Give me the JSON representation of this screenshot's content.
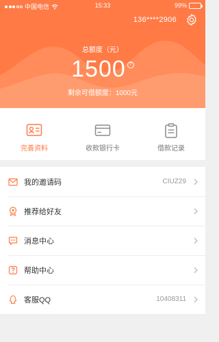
{
  "status_bar": {
    "carrier": "中国电信",
    "time": "15:33",
    "battery": "99%",
    "battery_level": 0.99
  },
  "header": {
    "phone": "136****2906",
    "settings_icon": "gear-icon",
    "total_label": "总额度（元）",
    "amount": "1500",
    "help_mark": "?",
    "remaining": "剩余可借额度：1000元",
    "background_color": "#ff7a45"
  },
  "quick_actions": [
    {
      "label": "完善资料",
      "icon": "id-card-icon",
      "active": true
    },
    {
      "label": "收款银行卡",
      "icon": "bank-card-icon",
      "active": false
    },
    {
      "label": "借款记录",
      "icon": "clipboard-icon",
      "active": false
    }
  ],
  "menu": [
    {
      "label": "我的邀请码",
      "value": "CIUZ29",
      "icon": "envelope-icon"
    },
    {
      "label": "推荐给好友",
      "value": "",
      "icon": "award-icon"
    },
    {
      "label": "消息中心",
      "value": "",
      "icon": "message-icon"
    },
    {
      "label": "帮助中心",
      "value": "",
      "icon": "help-icon"
    },
    {
      "label": "客服QQ",
      "value": "10408311",
      "icon": "qq-icon"
    }
  ],
  "colors": {
    "accent": "#ff7a45",
    "icon_gray": "#8a8a8a",
    "text": "#333333",
    "muted": "#999999"
  }
}
